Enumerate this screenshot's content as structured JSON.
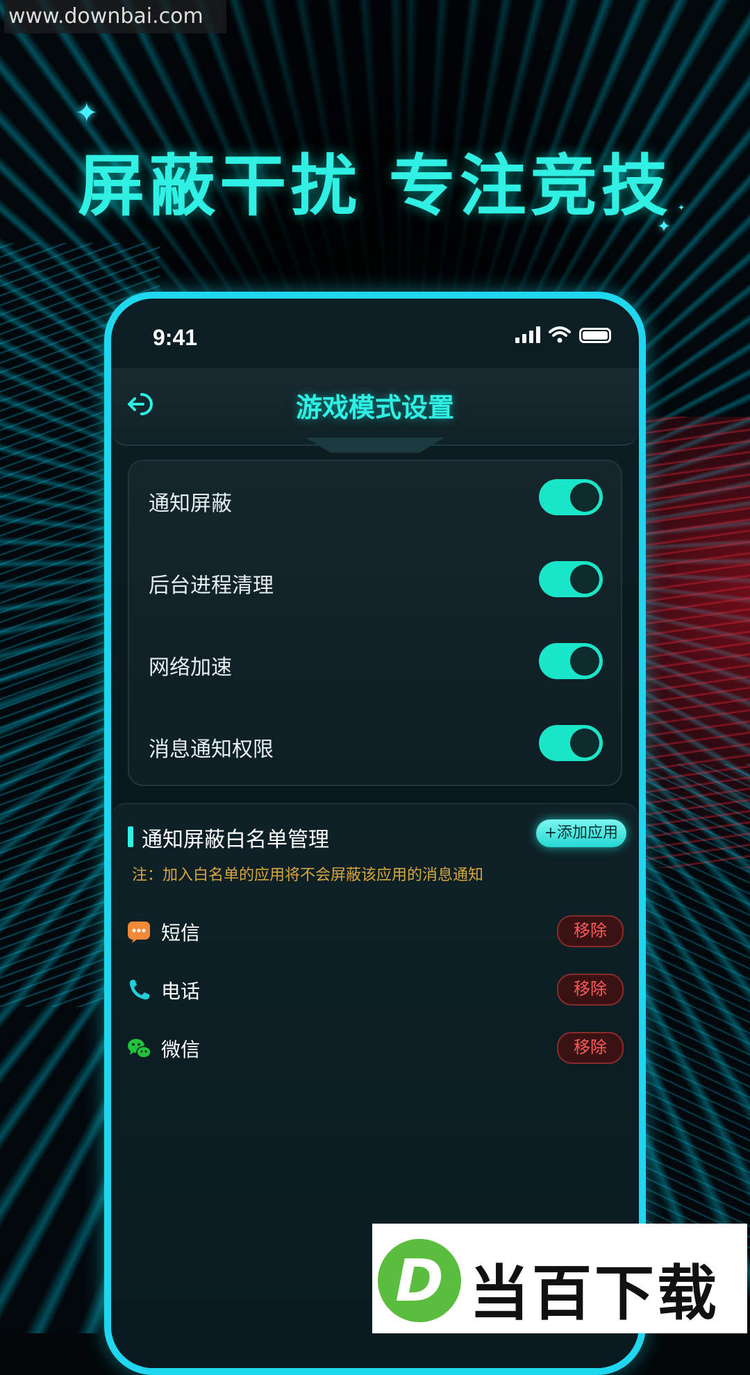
{
  "watermark": "www.downbai.com",
  "headline": "屏蔽干扰  专注竞技",
  "status_bar": {
    "time": "9:41"
  },
  "nav": {
    "title": "游戏模式设置",
    "back_icon": "back-arrow-icon"
  },
  "settings": [
    {
      "label": "通知屏蔽",
      "enabled": true
    },
    {
      "label": "后台进程清理",
      "enabled": true
    },
    {
      "label": "网络加速",
      "enabled": true
    },
    {
      "label": "消息通知权限",
      "enabled": true
    }
  ],
  "whitelist": {
    "title": "通知屏蔽白名单管理",
    "add_label": "+添加应用",
    "note": "注：加入白名单的应用将不会屏蔽该应用的消息通知",
    "apps": [
      {
        "name": "短信",
        "icon": "sms-icon",
        "color": "#f28a3a",
        "remove_label": "移除"
      },
      {
        "name": "电话",
        "icon": "phone-icon",
        "color": "#1fd0d8",
        "remove_label": "移除"
      },
      {
        "name": "微信",
        "icon": "wechat-icon",
        "color": "#22c23a",
        "remove_label": "移除"
      }
    ]
  },
  "brand": {
    "logo_letter": "D",
    "logo_text": "当百下载"
  },
  "colors": {
    "accent": "#2ff0e3",
    "toggle_on": "#19e6c9",
    "remove": "#ff5a5a",
    "note": "#d7a640"
  }
}
